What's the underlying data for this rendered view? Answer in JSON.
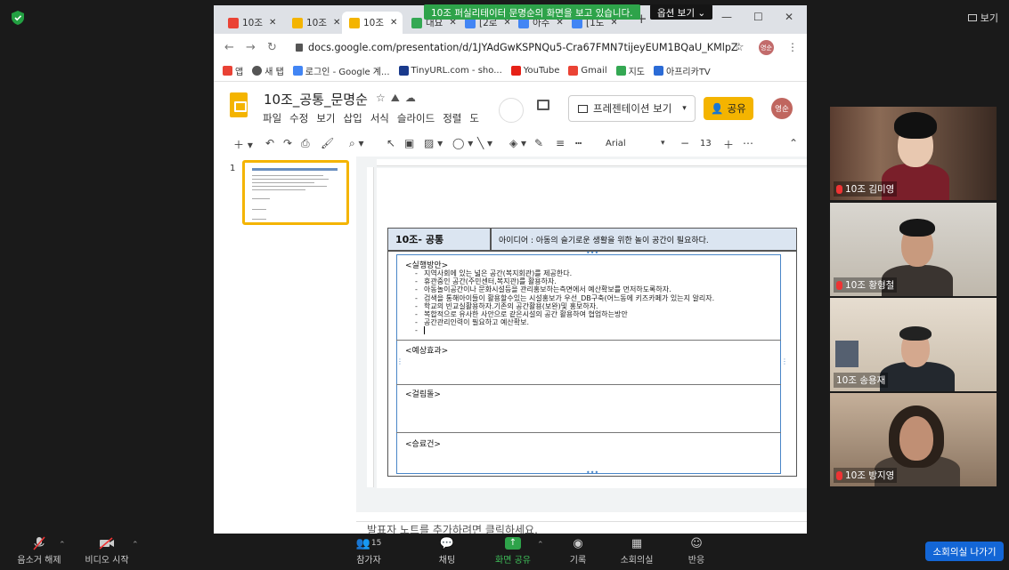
{
  "zoom": {
    "share_banner": "10조 퍼실리테이터 문명순의 화면을 보고 있습니다.",
    "option_label": "옵션 보기 ⌄",
    "view_label": "보기",
    "leave_label": "소회의실 나가기",
    "participant_count": "15",
    "bottom_items": [
      {
        "label": "음소거 해제",
        "icon": "mic-muted-icon"
      },
      {
        "label": "비디오 시작",
        "icon": "video-off-icon"
      },
      {
        "label": "참가자",
        "icon": "participants-icon"
      },
      {
        "label": "채팅",
        "icon": "chat-icon"
      },
      {
        "label": "화면 공유",
        "icon": "share-screen-icon"
      },
      {
        "label": "기록",
        "icon": "record-icon"
      },
      {
        "label": "소회의실",
        "icon": "breakout-icon"
      },
      {
        "label": "반응",
        "icon": "reaction-icon"
      }
    ],
    "participants": [
      {
        "name": "10조 김미영"
      },
      {
        "name": "10조 황형철"
      },
      {
        "name": "10조 송용재"
      },
      {
        "name": "10조 방지영"
      }
    ]
  },
  "browser": {
    "tabs": [
      {
        "label": "10조",
        "fav_color": "#ea4335"
      },
      {
        "label": "10조",
        "fav_color": "#f4b400"
      },
      {
        "label": "10조",
        "fav_color": "#f4b400"
      },
      {
        "label": "대요",
        "fav_color": "#34a853"
      },
      {
        "label": "[2로",
        "fav_color": "#4285f4"
      },
      {
        "label": "아주",
        "fav_color": "#4285f4"
      },
      {
        "label": "[1도",
        "fav_color": "#4285f4"
      }
    ],
    "url": "docs.google.com/presentation/d/1JYAdGwKSPNQu5-Cra67FMN7tijeyEUM1BQaU_KMlpZ8/e...",
    "profile_initials": "영순",
    "bookmarks": [
      {
        "label": "앱",
        "color": "#e94235"
      },
      {
        "label": "새 탭",
        "color": "#555"
      },
      {
        "label": "로그인 - Google 계...",
        "color": "#4285f4"
      },
      {
        "label": "TinyURL.com - sho...",
        "color": "#1a3a8c"
      },
      {
        "label": "YouTube",
        "color": "#e62117"
      },
      {
        "label": "Gmail",
        "color": "#ea4335"
      },
      {
        "label": "지도",
        "color": "#34a853"
      },
      {
        "label": "아프리카TV",
        "color": "#2b6bd6"
      }
    ]
  },
  "docs": {
    "title": "10조_공통_문명순",
    "menu": [
      "파일",
      "수정",
      "보기",
      "삽입",
      "서식",
      "슬라이드",
      "정렬",
      "도"
    ],
    "present_label": "프레젠테이션 보기",
    "share_label": "공유",
    "avatar_initials": "영순",
    "font_name": "Arial",
    "font_size": "13",
    "slide_number": "1",
    "notes_placeholder": "발표자 노트를 추가하려면 클릭하세요."
  },
  "slide": {
    "team": "10조- 공통",
    "idea": "아이디어 : 아동의 슬기로운 생활을 위한 놀이 공간이 필요하다.",
    "sections": {
      "plan": "<실행방안>",
      "effect": "<예상효과>",
      "obstacle": "<걸림돌>",
      "success": "<승료건>"
    },
    "plan_items": [
      "지역사회에 있는 넓은 공간(복지회관)를 제공한다.",
      "휴관중인 공간(주민센터,복지관)를 활용하자.",
      "아동놀이공간이나 문화시설등을 관리홍보하는측면에서 예산확보를 먼저하도록하자.",
      "검색을 통해아이들이 활용할수있는 시설홍보가 우선_DB구축(어느동에 키즈카페가 있는지 알리자.",
      "학교의 빈교실활용하자.기존의 공간활용(보완)및 홍보하자.",
      "복합적으로 유사한 사안으로 같은시설의 공간 활용하여 협업하는방안",
      "공간관리인력이 필요하고 예산확보.",
      ""
    ]
  }
}
